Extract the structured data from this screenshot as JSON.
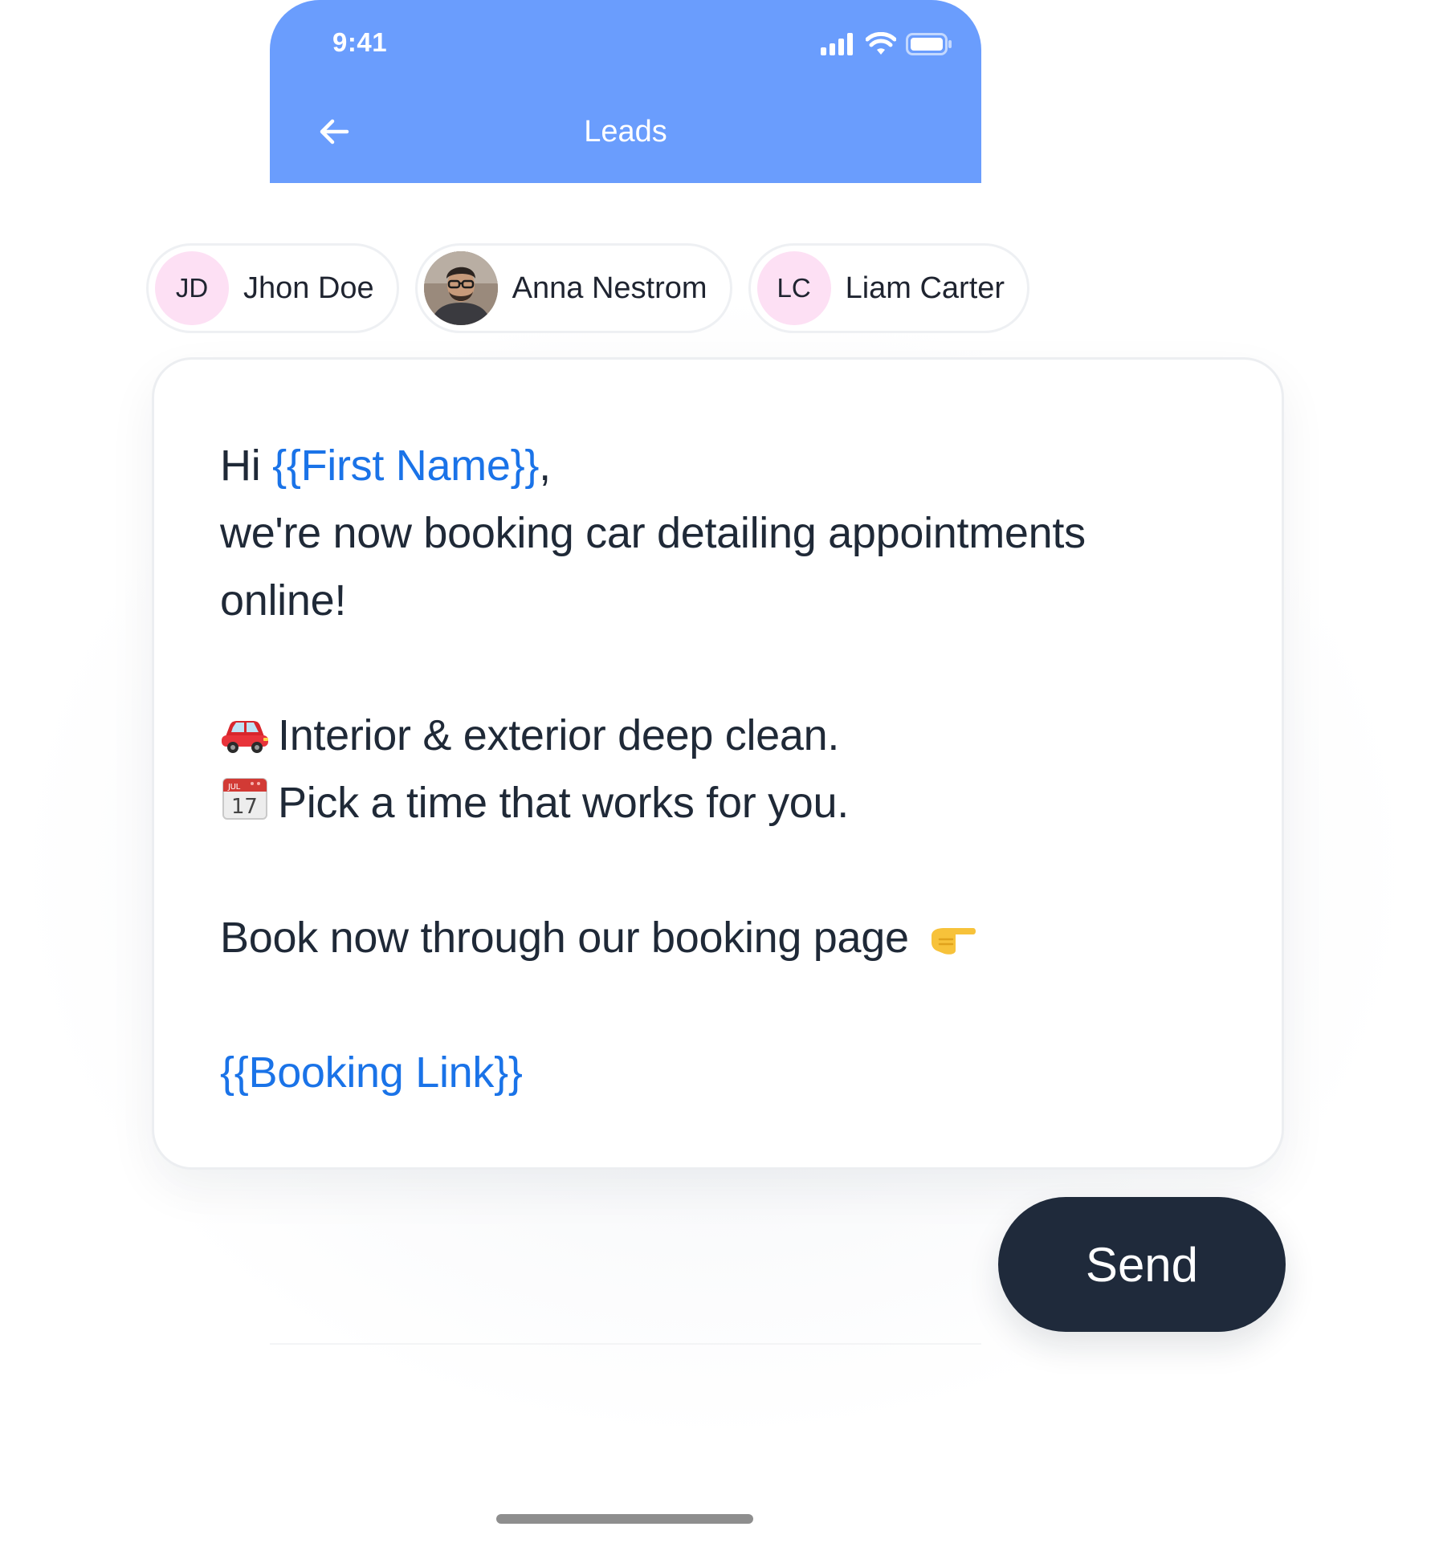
{
  "status_bar": {
    "time": "9:41"
  },
  "header": {
    "title": "Leads"
  },
  "leads": [
    {
      "initials": "JD",
      "name": "Jhon Doe",
      "has_photo": false
    },
    {
      "initials": "",
      "name": "Anna Nestrom",
      "has_photo": true
    },
    {
      "initials": "LC",
      "name": "Liam Carter",
      "has_photo": false
    }
  ],
  "message": {
    "greeting": "Hi ",
    "first_name_var": "{{First Name}}",
    "greeting_punct": ",",
    "line2": "we're now booking car detailing appointments",
    "line3": "online!",
    "bullet1_icon": "car-icon",
    "bullet1": "Interior & exterior deep clean.",
    "bullet2_icon": "calendar-icon",
    "bullet2": "Pick a time that works for you.",
    "cta": "Book now through our booking page",
    "cta_icon": "pointing-right-icon",
    "booking_link_var": "{{Booking Link}}"
  },
  "actions": {
    "send_label": "Send"
  },
  "colors": {
    "header_bg": "#6a9dfd",
    "variable_text": "#1a73e8",
    "send_bg": "#1f2a3b",
    "avatar_bg": "#fde0f4"
  }
}
